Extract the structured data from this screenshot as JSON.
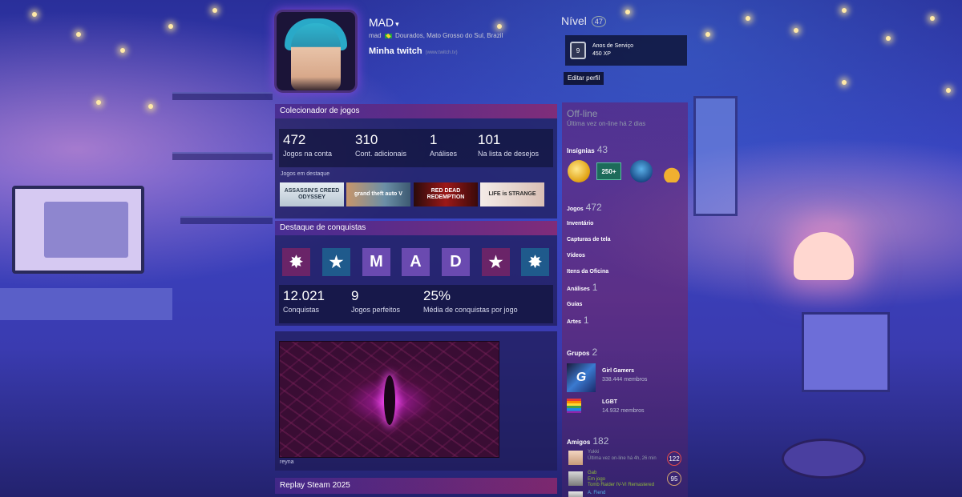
{
  "profile": {
    "name": "MAD",
    "caret": "▾",
    "real_name": "mad",
    "location": "Dourados, Mato Grosso do Sul, Brazil",
    "summary_title": "Minha twitch",
    "summary_link": "(www.twitch.tv)"
  },
  "level": {
    "label": "Nível",
    "value": "47",
    "badge_number": "9",
    "badge_title": "Anos de Serviço",
    "badge_xp": "450 XP",
    "edit_label": "Editar perfil"
  },
  "game_collector": {
    "title": "Colecionador de jogos",
    "stats": [
      {
        "num": "472",
        "label": "Jogos na conta"
      },
      {
        "num": "310",
        "label": "Cont. adicionais"
      },
      {
        "num": "1",
        "label": "Análises"
      },
      {
        "num": "101",
        "label": "Na lista de desejos"
      }
    ],
    "featured_label": "Jogos em destaque",
    "games": [
      {
        "name": "ASSASSIN'S CREED ODYSSEY",
        "color": "#c8d3dc"
      },
      {
        "name": "grand theft auto V",
        "color": "#6b8fa6"
      },
      {
        "name": "RED DEAD REDEMPTION",
        "color": "#9c1818"
      },
      {
        "name": "LIFE is STRANGE",
        "color": "#e9d9d2"
      }
    ]
  },
  "achievements": {
    "title": "Destaque de conquistas",
    "icons": [
      {
        "type": "burst",
        "glyph": "✸"
      },
      {
        "type": "star",
        "glyph": "★"
      },
      {
        "type": "letter",
        "glyph": "M"
      },
      {
        "type": "letter",
        "glyph": "A"
      },
      {
        "type": "letter",
        "glyph": "D"
      },
      {
        "type": "burst",
        "glyph": "★"
      },
      {
        "type": "star",
        "glyph": "✸"
      }
    ],
    "stats": [
      {
        "num": "12.021",
        "label": "Conquistas"
      },
      {
        "num": "9",
        "label": "Jogos perfeitos"
      },
      {
        "num": "25%",
        "label": "Média de conquistas por jogo"
      }
    ]
  },
  "artwork": {
    "caption": "reyna"
  },
  "replay": {
    "title": "Replay Steam 2025"
  },
  "sidebar": {
    "status": "Off-line",
    "last_online": "Última vez on-line há 2 dias",
    "badges_label": "Insígnias",
    "badges_count": "43",
    "badge_250_text": "250+",
    "links": [
      {
        "label": "Jogos",
        "count": "472"
      },
      {
        "label": "Inventário",
        "count": ""
      },
      {
        "label": "Capturas de tela",
        "count": ""
      },
      {
        "label": "Vídeos",
        "count": ""
      },
      {
        "label": "Itens da Oficina",
        "count": ""
      },
      {
        "label": "Análises",
        "count": "1"
      },
      {
        "label": "Guias",
        "count": ""
      },
      {
        "label": "Artes",
        "count": "1"
      }
    ],
    "groups_label": "Grupos",
    "groups_count": "2",
    "groups": [
      {
        "name": "Girl Gamers",
        "members": "338.444 membros"
      },
      {
        "name": "LGBT",
        "members": "14.932 membros"
      }
    ],
    "friends_label": "Amigos",
    "friends_count": "182",
    "friends": [
      {
        "name": "Yukki",
        "status": "Última vez on-line há 4h, 26 min",
        "detail": "",
        "level": "122",
        "ingame": false
      },
      {
        "name": "Gab",
        "status": "Em jogo",
        "detail": "Tomb Raider IV-VI Remastered",
        "level": "95",
        "ingame": true
      },
      {
        "name": "A. Fiend",
        "status": "",
        "detail": "",
        "level": "",
        "ingame": false
      }
    ]
  }
}
